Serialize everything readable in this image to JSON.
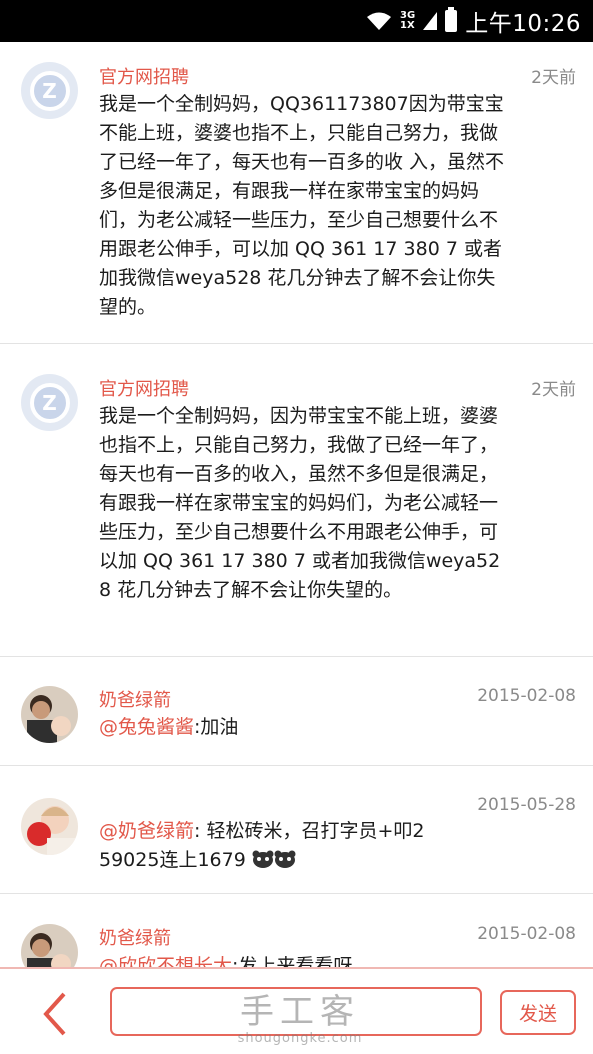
{
  "status_bar": {
    "network_top": "3G",
    "network_bottom": "1X",
    "time": "上午10:26"
  },
  "comments": [
    {
      "author": "官方网招聘",
      "time": "2天前",
      "avatar": "zhaopin-logo",
      "text": "我是一个全制妈妈，QQ361173807因为带宝宝不能上班，婆婆也指不上，只能自己努力，我做了已经一年了，每天也有一百多的收 入，虽然不多但是很满足，有跟我一样在家带宝宝的妈妈们，为老公减轻一些压力，至少自己想要什么不用跟老公伸手，可以加 QQ 361 17 380 7  或者加我微信weya528 花几分钟去了解不会让你失望的。"
    },
    {
      "author": "官方网招聘",
      "time": "2天前",
      "avatar": "zhaopin-logo",
      "text": "我是一个全制妈妈，因为带宝宝不能上班，婆婆也指不上，只能自己努力，我做了已经一年了，每天也有一百多的收入，虽然不多但是很满足，有跟我一样在家带宝宝的妈妈们，为老公减轻一些压力，至少自己想要什么不用跟老公伸手，可以加 QQ 361 17 380 7  或者加我微信weya528 花几分钟去了解不会让你失望的。"
    },
    {
      "author": "奶爸绿箭",
      "time": "2015-02-08",
      "avatar": "user-photo",
      "mention": "@兔兔酱酱",
      "text": ":加油"
    },
    {
      "author": "",
      "time": "2015-05-28",
      "avatar": "user-photo-child",
      "mention": "@奶爸绿箭",
      "text": ": 轻松砖米，召打字员+叩259025连上1679",
      "emojis": [
        "bear-emoji",
        "bear-emoji"
      ]
    },
    {
      "author": "奶爸绿箭",
      "time": "2015-02-08",
      "avatar": "user-photo",
      "mention": "@欣欣不想长大",
      "text": ":发上来看看呀"
    }
  ],
  "bottom_bar": {
    "send_label": "发送",
    "input_placeholder": ""
  },
  "watermark": {
    "main": "手工客",
    "sub": "shougongke.com"
  },
  "colors": {
    "accent": "#e2584a",
    "status_bar_bg": "#000000"
  }
}
